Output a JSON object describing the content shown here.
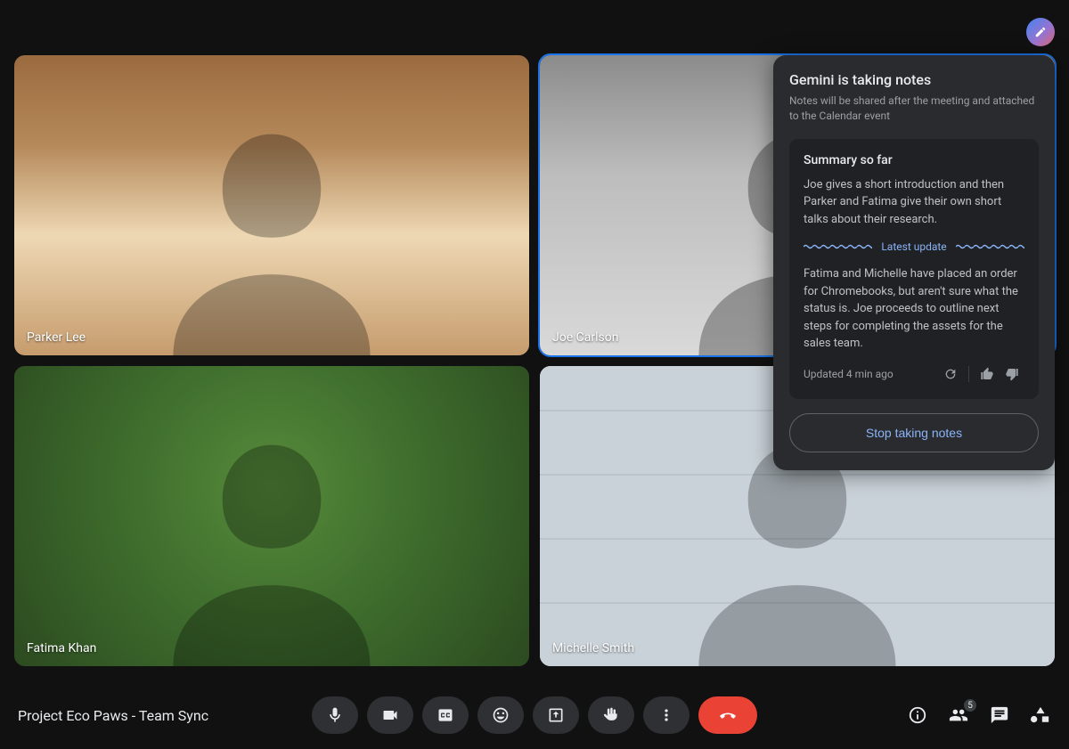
{
  "meeting_title": "Project Eco Paws - Team Sync",
  "participants": [
    {
      "name": "Parker Lee",
      "active_speaker": false
    },
    {
      "name": "Joe Carlson",
      "active_speaker": true
    },
    {
      "name": "Fatima Khan",
      "active_speaker": false
    },
    {
      "name": "Michelle Smith",
      "active_speaker": false
    }
  ],
  "participant_badge": "5",
  "controls": {
    "mic": "mic",
    "camera": "camera",
    "captions": "cc",
    "emoji": "emoji",
    "present": "present",
    "hand": "raise-hand",
    "more": "more",
    "end": "end-call"
  },
  "panel": {
    "title": "Gemini is taking notes",
    "subtitle": "Notes will be shared after the meeting and attached to the Calendar event",
    "summary_heading": "Summary so far",
    "summary_intro": "Joe gives a short introduction and then Parker and Fatima give their own short talks about their research.",
    "divider_label": "Latest update",
    "summary_update": "Fatima and Michelle have placed an order for Chromebooks, but aren't sure what the status is. Joe proceeds to outline next steps for completing the assets for the sales team.",
    "updated_label": "Updated 4 min ago",
    "stop_label": "Stop taking notes"
  }
}
